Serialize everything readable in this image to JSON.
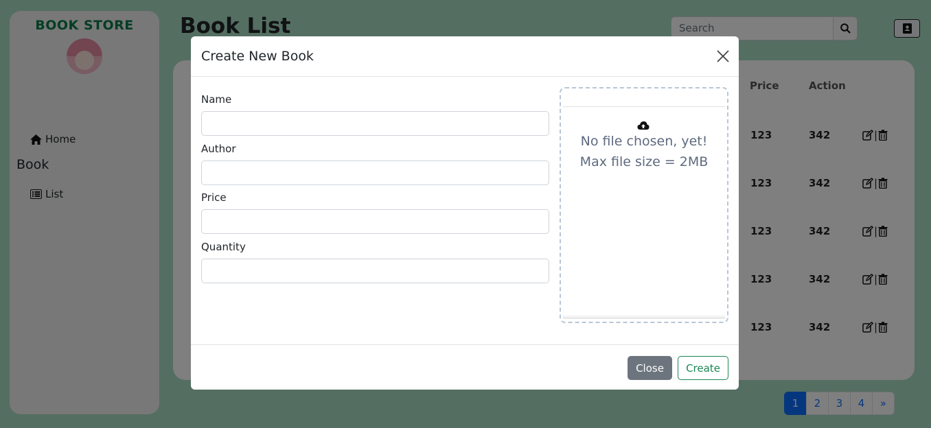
{
  "app": {
    "brand": "BOOK STORE",
    "page_title": "Book List",
    "search_placeholder": "Search"
  },
  "sidebar": {
    "home_label": "Home",
    "section_label": "Book",
    "list_label": "List"
  },
  "table": {
    "headers": [
      "Price",
      "Action"
    ],
    "rows": [
      {
        "price": "123",
        "action": "342"
      },
      {
        "price": "123",
        "action": "342"
      },
      {
        "price": "123",
        "action": "342"
      },
      {
        "price": "123",
        "action": "342"
      },
      {
        "price": "123",
        "action": "342"
      }
    ]
  },
  "pagination": {
    "pages": [
      "1",
      "2",
      "3",
      "4"
    ],
    "next": "»",
    "active_page": "1"
  },
  "modal": {
    "title": "Create New Book",
    "fields": [
      {
        "label": "Name",
        "value": ""
      },
      {
        "label": "Author",
        "value": ""
      },
      {
        "label": "Price",
        "value": ""
      },
      {
        "label": "Quantity",
        "value": ""
      }
    ],
    "dropzone_line1": "No file chosen, yet!",
    "dropzone_line2": "Max file size = 2MB",
    "close_button": "Close",
    "create_button": "Create"
  },
  "colors": {
    "brand": "#0b7a4a",
    "page_background": "#a8dcc4",
    "primary": "#0d6efd",
    "success": "#198754",
    "secondary": "#6c757d"
  },
  "icons": [
    "home-icon",
    "list-icon",
    "search-icon",
    "contact-book-icon",
    "edit-icon",
    "trash-icon",
    "close-icon",
    "cloud-upload-icon"
  ]
}
